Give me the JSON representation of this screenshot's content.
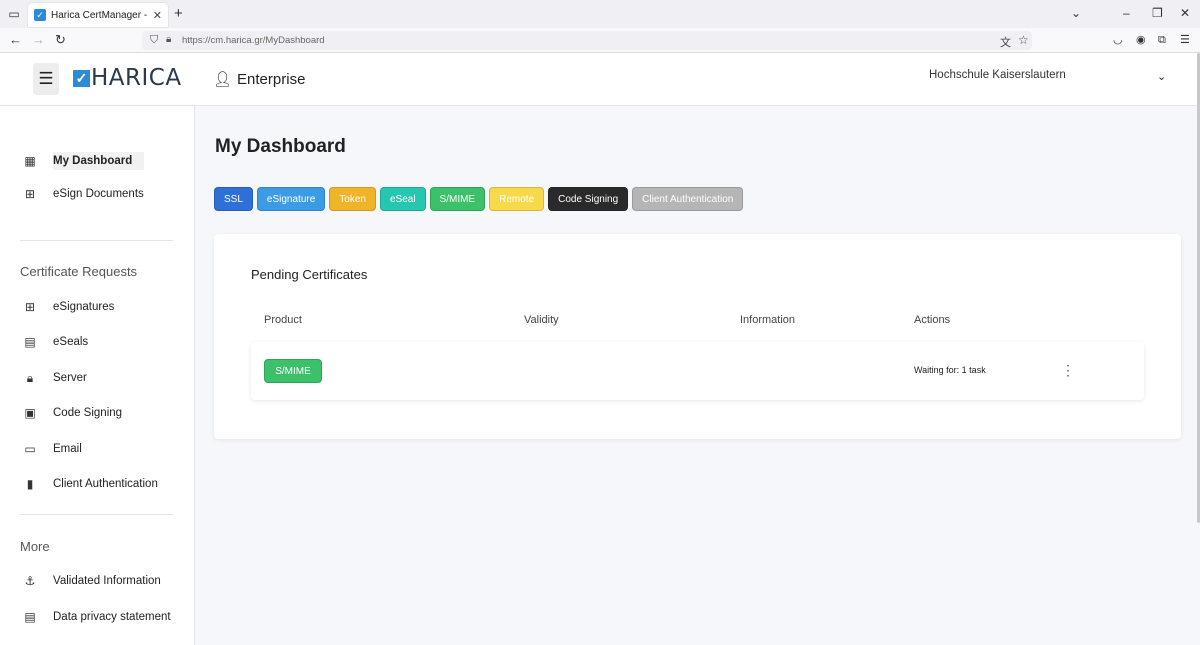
{
  "browser": {
    "tab_title": "Harica CertManager - My Dash",
    "url": "https://cm.harica.gr/MyDashboard",
    "icons": [
      "tab-list-icon",
      "close-icon",
      "plus-icon",
      "back-icon",
      "forward-icon",
      "reload-icon",
      "shield-icon",
      "lock-icon",
      "translate-icon",
      "star-icon",
      "pocket-icon",
      "account-icon",
      "extensions-icon",
      "menu-icon",
      "minimize-icon",
      "restore-icon",
      "window-close-icon"
    ]
  },
  "header": {
    "logo_text": "HARICA",
    "section_label": "Enterprise",
    "organization": "Hochschule Kaiserslautern"
  },
  "sidebar": {
    "top_items": [
      {
        "label": "My Dashboard",
        "icon": "dashboard-icon",
        "active": true
      },
      {
        "label": "eSign Documents",
        "icon": "esign-documents-icon"
      }
    ],
    "requests_heading": "Certificate Requests",
    "request_items": [
      {
        "label": "eSignatures",
        "icon": "esignature-icon"
      },
      {
        "label": "eSeals",
        "icon": "eseal-icon"
      },
      {
        "label": "Server",
        "icon": "lock-icon"
      },
      {
        "label": "Code Signing",
        "icon": "code-signing-icon"
      },
      {
        "label": "Email",
        "icon": "email-icon"
      },
      {
        "label": "Client Authentication",
        "icon": "client-auth-icon"
      }
    ],
    "more_heading": "More",
    "more_items": [
      {
        "label": "Validated Information",
        "icon": "anchor-icon"
      },
      {
        "label": "Data privacy statement",
        "icon": "privacy-icon"
      }
    ]
  },
  "main": {
    "title": "My Dashboard",
    "filters": [
      {
        "label": "SSL",
        "color": "#2f6fd8"
      },
      {
        "label": "eSignature",
        "color": "#3d9be6"
      },
      {
        "label": "Token",
        "color": "#f0b429"
      },
      {
        "label": "eSeal",
        "color": "#26c6b0"
      },
      {
        "label": "S/MIME",
        "color": "#3cc06a"
      },
      {
        "label": "Remote",
        "color": "#f8d94a"
      },
      {
        "label": "Code Signing",
        "color": "#2a2a2a"
      },
      {
        "label": "Client Authentication",
        "color": "#b5b5b5"
      }
    ],
    "pending": {
      "title": "Pending Certificates",
      "columns": [
        "Product",
        "Validity",
        "Information",
        "Actions"
      ],
      "rows": [
        {
          "product": "S/MIME",
          "validity": "",
          "information": "",
          "status": "Waiting for: 1 task"
        }
      ]
    }
  }
}
